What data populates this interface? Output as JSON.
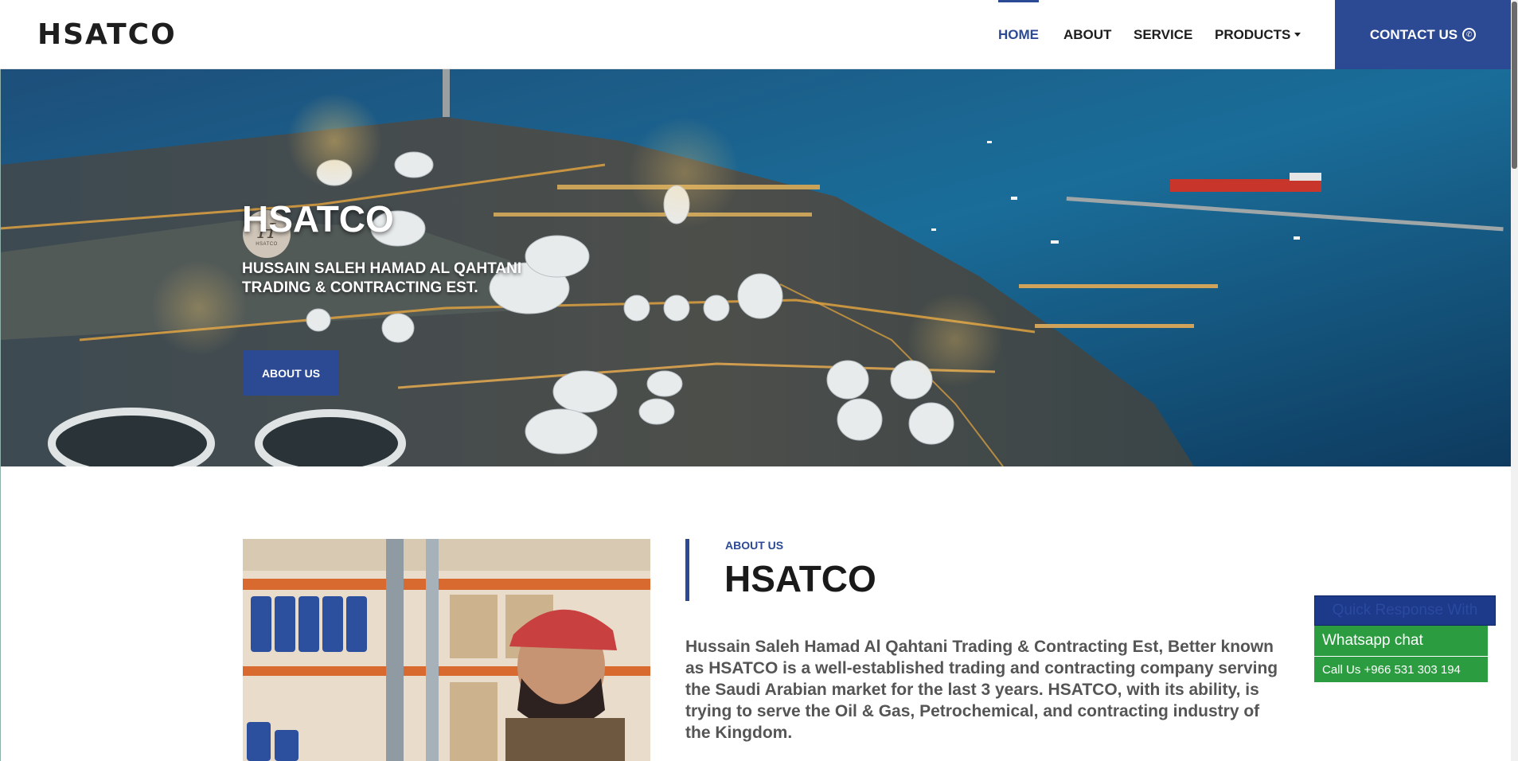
{
  "nav": {
    "logo": "HSATCO",
    "items": [
      {
        "label": "HOME",
        "active": true
      },
      {
        "label": "ABOUT",
        "active": false
      },
      {
        "label": "SERVICE",
        "active": false
      },
      {
        "label": "PRODUCTS",
        "active": false,
        "dropdown": true
      }
    ],
    "contact_label": "CONTACT US",
    "contact_icon": "whatsapp-icon"
  },
  "hero": {
    "logo_mark": "H",
    "logo_text": "HSATCO",
    "title": "HSATCO",
    "subtitle": "HUSSAIN SALEH HAMAD AL QAHTANI TRADING & CONTRACTING EST.",
    "button_label": "ABOUT US",
    "image": "night aerial of industrial port with storage tanks and ships"
  },
  "about": {
    "kicker": "ABOUT US",
    "title": "HSATCO",
    "text": "Hussain Saleh Hamad Al Qahtani Trading & Contracting Est, Better known as HSATCO is a well-established trading and contracting company serving the Saudi Arabian market for the last 3 years. HSATCO, with its ability, is trying to serve the Oil & Gas, Petrochemical, and contracting industry of the Kingdom.",
    "image": "warehouse worker in red cap with shelves"
  },
  "widget": {
    "quick_label": "Quick Response With",
    "whatsapp_label": "Whatsapp chat",
    "call_label": "Call Us +966 531 303 194"
  },
  "colors": {
    "brand": "#2c4a94",
    "whatsapp": "#2c9c41"
  }
}
